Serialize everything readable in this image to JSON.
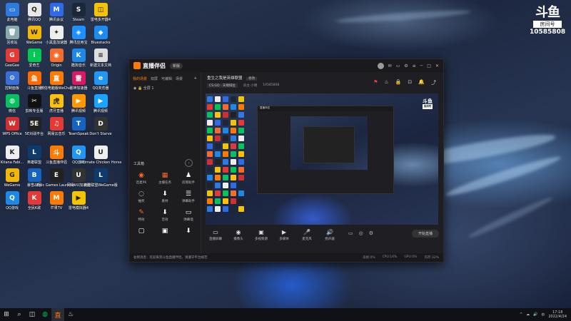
{
  "desktop": {
    "icons": [
      {
        "label": "此电脑",
        "color": "#2d7be0",
        "glyph": "▭"
      },
      {
        "label": "腾讯QQ",
        "color": "#e8e8e8",
        "glyph": "Q"
      },
      {
        "label": "腾讯会议",
        "color": "#2f6be8",
        "glyph": "M"
      },
      {
        "label": "Steam",
        "color": "#1b2838",
        "glyph": "S"
      },
      {
        "label": "雷电多开器4",
        "color": "#f5c400",
        "glyph": "◫"
      },
      {
        "label": "回收站",
        "color": "#8aa",
        "glyph": "🗑"
      },
      {
        "label": "WeGame",
        "color": "#f2b705",
        "glyph": "W"
      },
      {
        "label": "小黑盒加速器",
        "color": "#eee",
        "glyph": "✦"
      },
      {
        "label": "腾讯应用宝",
        "color": "#1e90ff",
        "glyph": "◈"
      },
      {
        "label": "Bluestacks",
        "color": "#1c8cf0",
        "glyph": "◆"
      },
      {
        "label": "GeeGee",
        "color": "#e53935",
        "glyph": "G"
      },
      {
        "label": "爱奇艺",
        "color": "#00c853",
        "glyph": "i"
      },
      {
        "label": "Origin",
        "color": "#f56c2d",
        "glyph": "◉"
      },
      {
        "label": "酷狗音乐",
        "color": "#1e88e5",
        "glyph": "K"
      },
      {
        "label": "新建文本文档",
        "color": "#ddd",
        "glyph": "≡"
      },
      {
        "label": "控制面板",
        "color": "#3a6fd8",
        "glyph": "⚙"
      },
      {
        "label": "斗鱼直播",
        "color": "#ff6a00",
        "glyph": "鱼"
      },
      {
        "label": "微信电脑版WeChat",
        "color": "#ff7a00",
        "glyph": "直"
      },
      {
        "label": "雷神加速器",
        "color": "#d81b60",
        "glyph": "雷"
      },
      {
        "label": "QQ浏览器",
        "color": "#2196f3",
        "glyph": "e"
      },
      {
        "label": "微信",
        "color": "#07c160",
        "glyph": "◍"
      },
      {
        "label": "剪映专业版",
        "color": "#111",
        "glyph": "✂"
      },
      {
        "label": "虎牙直播",
        "color": "#ffc107",
        "glyph": "虎"
      },
      {
        "label": "腾讯视频",
        "color": "#ff9800",
        "glyph": "▶"
      },
      {
        "label": "腾讯视频",
        "color": "#1aa3ff",
        "glyph": "▶"
      },
      {
        "label": "WPS Office",
        "color": "#d32f2f",
        "glyph": "W"
      },
      {
        "label": "5E对战平台",
        "color": "#222",
        "glyph": "5E"
      },
      {
        "label": "网易云音乐",
        "color": "#e53935",
        "glyph": "♫"
      },
      {
        "label": "TeamSpeak",
        "color": "#1565c0",
        "glyph": "T"
      },
      {
        "label": "Don't Starve",
        "color": "#333",
        "glyph": "D"
      },
      {
        "label": "Kitana Fabi...",
        "color": "#eee",
        "glyph": "K"
      },
      {
        "label": "英雄联盟",
        "color": "#0e3b6b",
        "glyph": "L"
      },
      {
        "label": "斗鱼直播伴侣",
        "color": "#ff7a00",
        "glyph": "斗"
      },
      {
        "label": "QQ游戏",
        "color": "#2196f3",
        "glyph": "Q"
      },
      {
        "label": "Ultimate Chicken Horse",
        "color": "#eee",
        "glyph": "U"
      },
      {
        "label": "WeGame",
        "color": "#f2b705",
        "glyph": "G"
      },
      {
        "label": "暴雪战网",
        "color": "#1565c0",
        "glyph": "B"
      },
      {
        "label": "Epic Games Launcher",
        "color": "#222",
        "glyph": "E"
      },
      {
        "label": "网易UU加速器",
        "color": "#333",
        "glyph": "U"
      },
      {
        "label": "英雄联盟WeGame版",
        "color": "#0e3b6b",
        "glyph": "L"
      },
      {
        "label": "QQ游戏",
        "color": "#1e88e5",
        "glyph": "Q"
      },
      {
        "label": "全民K歌",
        "color": "#e53935",
        "glyph": "K"
      },
      {
        "label": "芒果TV",
        "color": "#ff7a00",
        "glyph": "M"
      },
      {
        "label": "雷电模拟器4",
        "color": "#f5c400",
        "glyph": "▶"
      }
    ]
  },
  "watermark": {
    "logo": "斗鱼",
    "room_label": "房间号",
    "room_id": "10585808"
  },
  "app": {
    "logo": "直播伴侣",
    "version_badge": "新版",
    "left_tabs": [
      "我的场景",
      "双屏",
      "可编辑",
      "场景"
    ],
    "scene_label": "全屏 1",
    "toolbox_title": "工具箱",
    "tools": [
      {
        "icon": "◉",
        "label": "连麦PK"
      },
      {
        "icon": "▦",
        "label": "主播任务"
      },
      {
        "icon": "♟",
        "label": "房管助手"
      },
      {
        "icon": "◌",
        "label": "抽奖"
      },
      {
        "icon": "⬇",
        "label": "素材"
      },
      {
        "icon": "☰",
        "label": "弹幕助手"
      },
      {
        "icon": "✎",
        "label": "特效"
      },
      {
        "icon": "⬇",
        "label": "音效"
      },
      {
        "icon": "▭",
        "label": "弹幕墙"
      },
      {
        "icon": "▢",
        "label": ""
      },
      {
        "icon": "▣",
        "label": ""
      },
      {
        "icon": "⬇",
        "label": ""
      }
    ],
    "status_text": "右侧消息：欢迎来到斗鱼直播伴侣，请遵守平台规范",
    "room_title": "重生之我是英雄联盟",
    "room_edit": "修改",
    "room_category": "CS:GO · 天梯排位",
    "room_meta": [
      "房主·小明",
      "10585808"
    ],
    "header_icons": [
      "⚑",
      "♨",
      "🔒",
      "⊡",
      "🔔",
      "⤴"
    ],
    "controls": [
      {
        "icon": "▭",
        "label": "直播屏幕"
      },
      {
        "icon": "◉",
        "label": "摄像头"
      },
      {
        "icon": "▣",
        "label": "多视频源"
      },
      {
        "icon": "▶",
        "label": "多媒体"
      },
      {
        "icon": "🎤",
        "label": "麦克风"
      },
      {
        "icon": "🔊",
        "label": "扬声器"
      }
    ],
    "small_controls": [
      "▭",
      "◎",
      "⚙"
    ],
    "start_button": "开始直播",
    "stats": [
      "丢帧:0%",
      "CPU:14%",
      "GPU:0%",
      "内存:32%"
    ],
    "window_controls": [
      "─",
      "□",
      "✕"
    ]
  },
  "taskbar": {
    "items": [
      "⊞",
      "⌕",
      "◫",
      "◍",
      "直",
      "♨"
    ],
    "tray": [
      "^",
      "☁",
      "🔊",
      "中"
    ],
    "time": "17:18",
    "date": "2022/4/24"
  }
}
